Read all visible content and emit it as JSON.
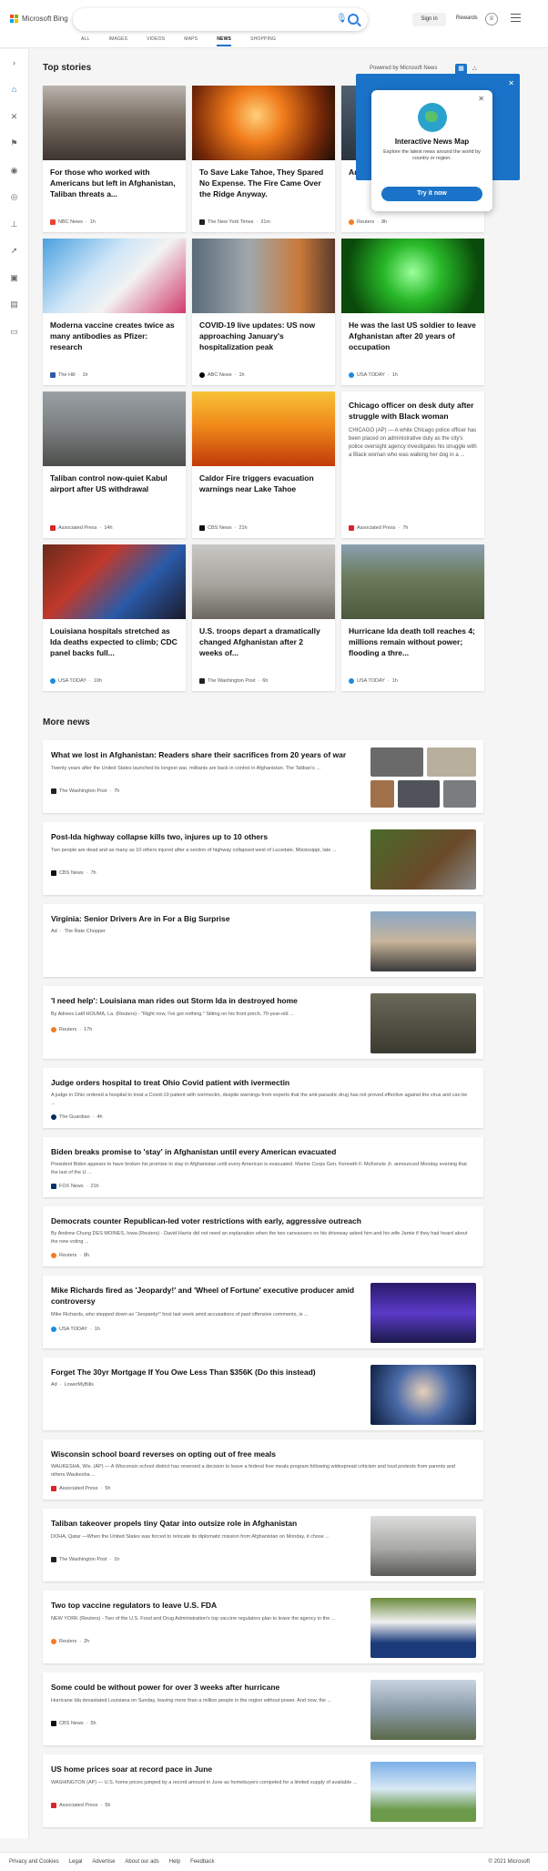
{
  "header": {
    "brand": "Microsoft Bing",
    "signin_label": "Sign in",
    "rewards_label": "Rewards",
    "rewards_icon": "trophy-icon",
    "tabs": [
      {
        "label": "ALL",
        "active": false
      },
      {
        "label": "IMAGES",
        "active": false
      },
      {
        "label": "VIDEOS",
        "active": false
      },
      {
        "label": "MAPS",
        "active": false
      },
      {
        "label": "NEWS",
        "active": true
      },
      {
        "label": "SHOPPING",
        "active": false
      }
    ]
  },
  "colors": {
    "accent": "#1a73c8",
    "ms_red": "#f25022",
    "ms_green": "#7fba00",
    "ms_blue": "#00a4ef",
    "ms_yellow": "#ffb900"
  },
  "top_stories": {
    "title": "Top stories",
    "powered_by": "Powered by Microsoft News",
    "cards": [
      {
        "title": "For those who worked with Americans but left in Afghanistan, Taliban threats a...",
        "source": "NBC News",
        "time": "1h"
      },
      {
        "title": "To Save Lake Tahoe, They Spared No Expense. The Fire Came Over the Ridge Anyway.",
        "source": "The New York Times",
        "time": "31m"
      },
      {
        "title": "Analy... dwin... chall...",
        "source": "Reuters",
        "time": "8h"
      },
      {
        "title": "Moderna vaccine creates twice as many antibodies as Pfizer: research",
        "source": "The Hill",
        "time": "1h"
      },
      {
        "title": "COVID-19 live updates: US now approaching January's hospitalization peak",
        "source": "ABC News",
        "time": "1h"
      },
      {
        "title": "He was the last US soldier to leave Afghanistan after 20 years of occupation",
        "source": "USA TODAY",
        "time": "1h"
      },
      {
        "title": "Taliban control now-quiet Kabul airport after US withdrawal",
        "source": "Associated Press",
        "time": "14h"
      },
      {
        "title": "Caldor Fire triggers evacuation warnings near Lake Tahoe",
        "source": "CBS News",
        "time": "21h"
      },
      {
        "title": "Chicago officer on desk duty after struggle with Black woman",
        "snippet": "CHICAGO (AP) — A white Chicago police officer has been placed on administrative duty as the city's police oversight agency investigates his struggle with a Black woman who was walking her dog in a ...",
        "source": "Associated Press",
        "time": "7h"
      },
      {
        "title": "Louisiana hospitals stretched as Ida deaths expected to climb; CDC panel backs full...",
        "source": "USA TODAY",
        "time": "10h"
      },
      {
        "title": "U.S. troops depart a dramatically changed Afghanistan after 2 weeks of...",
        "source": "The Washington Post",
        "time": "6h"
      },
      {
        "title": "Hurricane Ida death toll reaches 4; millions remain without power; flooding a thre...",
        "source": "USA TODAY",
        "time": "1h"
      }
    ]
  },
  "popup": {
    "title": "Interactive News Map",
    "description": "Explore the latest news around the world by country or region.",
    "button": "Try it now"
  },
  "more_news": {
    "title": "More news",
    "items": [
      {
        "title": "What we lost in Afghanistan: Readers share their sacrifices from 20 years of war",
        "snippet": "Twenty years after the United States launched its longest war, militants are back in control in Afghanistan. The Taliban's ...",
        "source": "The Washington Post",
        "time": "7h"
      },
      {
        "title": "Post-Ida highway collapse kills two, injures up to 10 others",
        "snippet": "Two people are dead and as many as 10 others injured after a section of highway collapsed west of Lucedale, Mississippi, late ...",
        "source": "CBS News",
        "time": "7h"
      },
      {
        "title": "Virginia: Senior Drivers Are in For a Big Surprise",
        "snippet": "",
        "source": "The Rate Chopper",
        "ad_label": "Ad",
        "time": ""
      },
      {
        "title": "'I need help': Louisiana man rides out Storm Ida in destroyed home",
        "snippet": "By Adrees Latif HOUMA, La. (Reuters) - \"Right now, I've got nothing.\" Sitting on his front porch, 70-year-old ...",
        "source": "Reuters",
        "time": "17h"
      },
      {
        "title": "Judge orders hospital to treat Ohio Covid patient with ivermectin",
        "snippet": "A judge in Ohio ordered a hospital to treat a Covid-19 patient with ivermectin, despite warnings from experts that the anti-parasitic drug has not proved effective against the virus and can be ...",
        "source": "The Guardian",
        "time": "4h"
      },
      {
        "title": "Biden breaks promise to 'stay' in Afghanistan until every American evacuated",
        "snippet": "President Biden appears to have broken his promise to stay in Afghanistan until every American is evacuated. Marine Corps Gen. Kenneth F. McKenzie Jr. announced Monday evening that the last of the U ...",
        "source": "FOX News",
        "time": "21h"
      },
      {
        "title": "Democrats counter Republican-led voter restrictions with early, aggressive outreach",
        "snippet": "By Andrew Chung DES MOINES, Iowa (Reuters) - David Harris did not need an explanation when the two canvassers on his driveway asked him and his wife Jamie if they had heard about the new voting ...",
        "source": "Reuters",
        "time": "8h"
      },
      {
        "title": "Mike Richards fired as 'Jeopardy!' and 'Wheel of Fortune' executive producer amid controversy",
        "snippet": "Mike Richards, who stepped down as \"Jeopardy!\" host last week amid accusations of past offensive comments, is ...",
        "source": "USA TODAY",
        "time": "1h"
      },
      {
        "title": "Forget The 30yr Mortgage If You Owe Less Than $356K (Do this instead)",
        "snippet": "",
        "source": "LowerMyBills",
        "ad_label": "Ad",
        "time": ""
      },
      {
        "title": "Wisconsin school board reverses on opting out of free meals",
        "snippet": "WAUKESHA, Wis. (AP) — A Wisconsin school district has reversed a decision to leave a federal free meals program following widespread criticism and loud protests from parents and others.Waukesha ...",
        "source": "Associated Press",
        "time": "5h"
      },
      {
        "title": "Taliban takeover propels tiny Qatar into outsize role in Afghanistan",
        "snippet": "DOHA, Qatar —When the United States was forced to relocate its diplomatic mission from Afghanistan on Monday, it chose ...",
        "source": "The Washington Post",
        "time": "1h"
      },
      {
        "title": "Two top vaccine regulators to leave U.S. FDA",
        "snippet": "NEW YORK (Reuters) - Two of the U.S. Food and Drug Administration's top vaccine regulators plan to leave the agency in the ...",
        "source": "Reuters",
        "time": "2h"
      },
      {
        "title": "Some could be without power for over 3 weeks after hurricane",
        "snippet": "Hurricane Ida devastated Louisiana on Sunday, leaving more than a million people in the region without power. And now, the ...",
        "source": "CBS News",
        "time": "5h"
      },
      {
        "title": "US home prices soar at record pace in June",
        "snippet": "WASHINGTON (AP) — U.S. home prices jumped by a record amount in June as homebuyers competed for a limited supply of available ...",
        "source": "Associated Press",
        "time": "5h"
      }
    ]
  },
  "footer": {
    "links": [
      "Privacy and Cookies",
      "Legal",
      "Advertise",
      "About our ads",
      "Help",
      "Feedback"
    ],
    "copyright": "© 2021 Microsoft"
  }
}
